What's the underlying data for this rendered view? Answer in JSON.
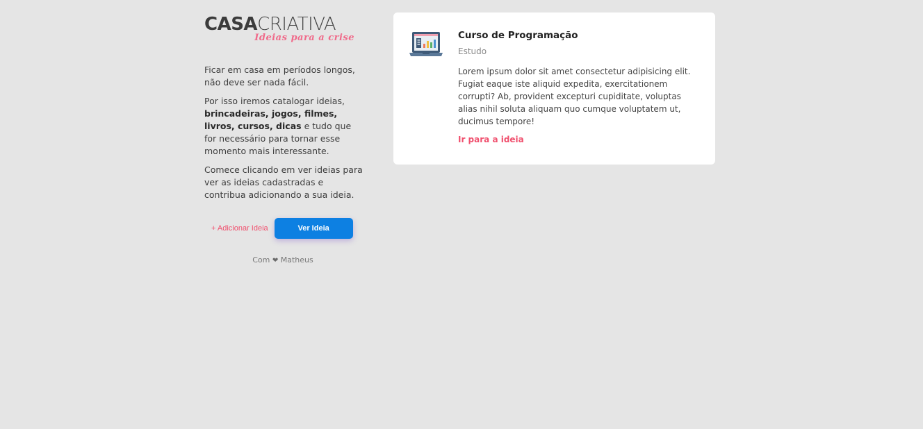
{
  "logo": {
    "part1": "CASA",
    "part2": "CRIATIVA",
    "tagline": "Ideias para a crise"
  },
  "intro": {
    "p1": "Ficar em casa em períodos longos, não deve ser nada fácil.",
    "p2_start": "Por isso iremos catalogar ideias,",
    "p2_bold": "brincadeiras, jogos, filmes, livros, cursos, dicas",
    "p2_end": "e tudo que for necessário para tornar esse momento mais interessante.",
    "p3": "Comece clicando em ver ideias para ver as ideias cadastradas e contribua adicionando a sua ideia."
  },
  "actions": {
    "add_label": "+ Adicionar Ideia",
    "view_label": "Ver Ideia"
  },
  "footer": {
    "prefix": "Com",
    "heart": "❤",
    "author": "Matheus"
  },
  "idea": {
    "icon": "laptop-chart-icon",
    "title": "Curso de Programação",
    "category": "Estudo",
    "description": "Lorem ipsum dolor sit amet consectetur adipisicing elit. Fugiat eaque iste aliquid expedita, exercitationem corrupti? Ab, provident excepturi cupiditate, voluptas alias nihil soluta aliquam quo cumque voluptatem ut, ducimus tempore!",
    "link_label": "Ir para a ideia"
  },
  "colors": {
    "accent": "#f0506e",
    "button": "#0d80e2",
    "background": "#e5e5e5"
  }
}
